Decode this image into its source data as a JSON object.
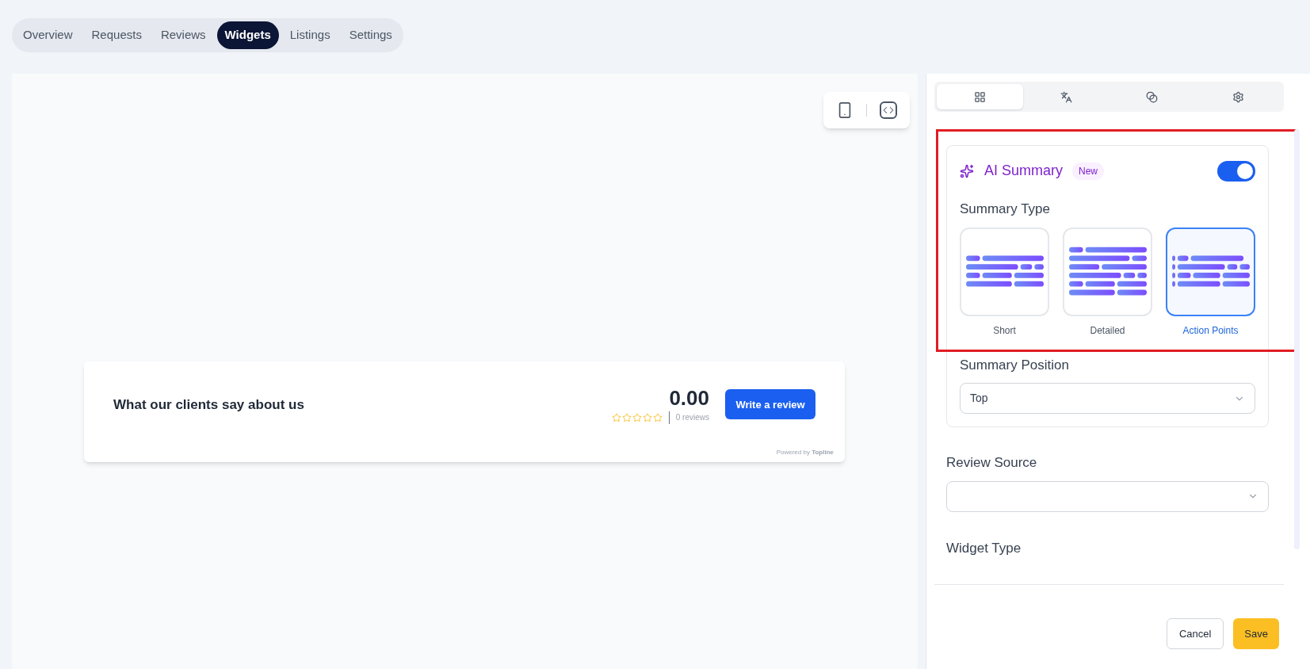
{
  "nav_tabs": [
    {
      "label": "Overview",
      "selected": false
    },
    {
      "label": "Requests",
      "selected": false
    },
    {
      "label": "Reviews",
      "selected": false
    },
    {
      "label": "Widgets",
      "selected": true
    },
    {
      "label": "Listings",
      "selected": false
    },
    {
      "label": "Settings",
      "selected": false
    }
  ],
  "preview": {
    "widget": {
      "title": "What our clients say about us",
      "rating": "0.00",
      "stars": 0,
      "reviews_count": "0 reviews",
      "button": "Write a review",
      "powered_by": "Powered by **Topline**"
    }
  },
  "settings_tabs": [
    {
      "kind": "layout",
      "selected": true
    },
    {
      "kind": "language",
      "selected": false
    },
    {
      "kind": "colors",
      "selected": false
    },
    {
      "kind": "settings",
      "selected": false
    }
  ],
  "ai_summary": {
    "title": "AI Summary",
    "badge": "New",
    "on": true,
    "highlighted": true,
    "summary_type": {
      "label": "Summary Type",
      "options": [
        {
          "kind": "short",
          "label": "Short",
          "selected": false
        },
        {
          "kind": "detailed",
          "label": "Detailed",
          "selected": false
        },
        {
          "kind": "action_points",
          "label": "Action Points",
          "selected": true
        }
      ]
    },
    "summary_position": {
      "label": "Summary Position",
      "value": "Top"
    }
  },
  "review_source": {
    "label": "Review Source"
  },
  "widget_type": {
    "label": "Widget Type"
  },
  "buttons": {
    "cancel": "Cancel",
    "save": "Save"
  }
}
